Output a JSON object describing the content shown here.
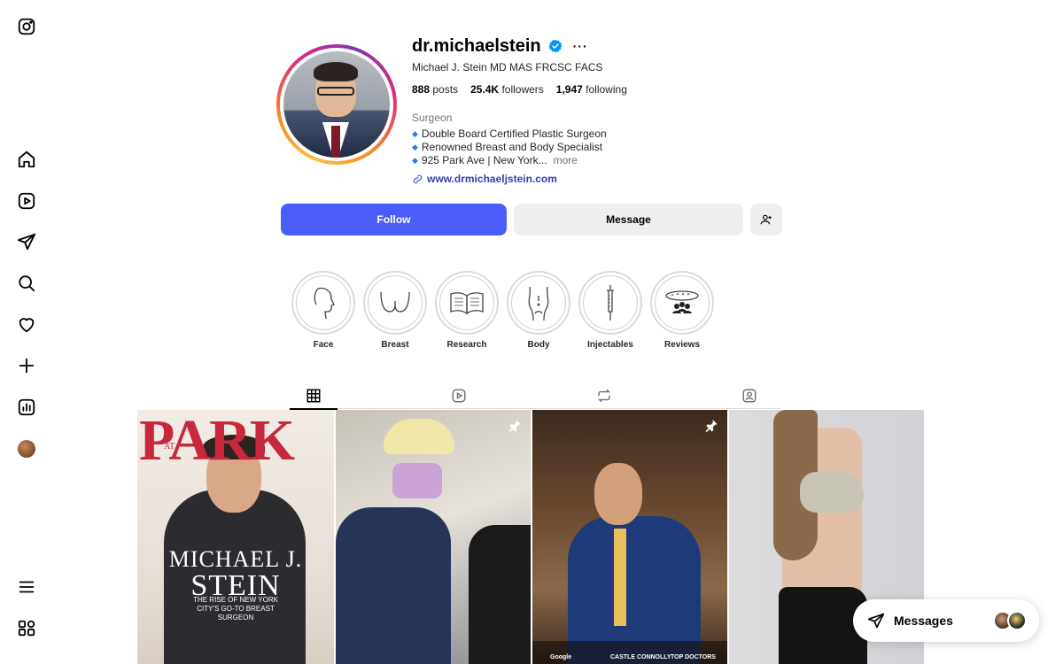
{
  "profile": {
    "username": "dr.michaelstein",
    "more_label": "···",
    "full_name": "Michael J. Stein MD MAS FRCSC FACS",
    "stats": [
      {
        "value": "888",
        "label": "posts"
      },
      {
        "value": "25.4K",
        "label": "followers"
      },
      {
        "value": "1,947",
        "label": "following"
      }
    ],
    "category": "Surgeon",
    "bio_lines": [
      "Double Board Certified Plastic Surgeon",
      "Renowned Breast and Body Specialist",
      "925 Park Ave | New York..."
    ],
    "bio_more": "more",
    "link": "www.drmichaeljstein.com",
    "verified_color": "#0095f6"
  },
  "actions": {
    "follow": "Follow",
    "message": "Message"
  },
  "highlights": [
    {
      "label": "Face",
      "icon": "face-profile-icon"
    },
    {
      "label": "Breast",
      "icon": "breast-outline-icon"
    },
    {
      "label": "Research",
      "icon": "open-book-icon"
    },
    {
      "label": "Body",
      "icon": "body-outline-icon"
    },
    {
      "label": "Injectables",
      "icon": "syringe-icon"
    },
    {
      "label": "Reviews",
      "icon": "stars-people-icon"
    }
  ],
  "tabs": [
    {
      "name": "posts",
      "icon": "grid-icon",
      "active": true
    },
    {
      "name": "reels",
      "icon": "reels-icon",
      "active": false
    },
    {
      "name": "reposts",
      "icon": "repost-icon",
      "active": false
    },
    {
      "name": "tagged",
      "icon": "tagged-icon",
      "active": false
    }
  ],
  "posts": {
    "p1": {
      "masthead": "PARK",
      "masthead_sub": "AT",
      "cover_name_1": "MICHAEL J.",
      "cover_name_2": "STEIN",
      "cover_tag_1": "THE RISE OF NEW YORK",
      "cover_tag_2": "CITY'S GO-TO BREAST",
      "cover_tag_3": "SURGEON"
    },
    "p3": {
      "badge_1": "Google",
      "badge_2": "CASTLE CONNOLLY",
      "badge_3": "TOP DOCTORS"
    }
  },
  "messages": {
    "label": "Messages"
  },
  "colors": {
    "accent": "#4a5df9",
    "link": "#3140b0"
  }
}
